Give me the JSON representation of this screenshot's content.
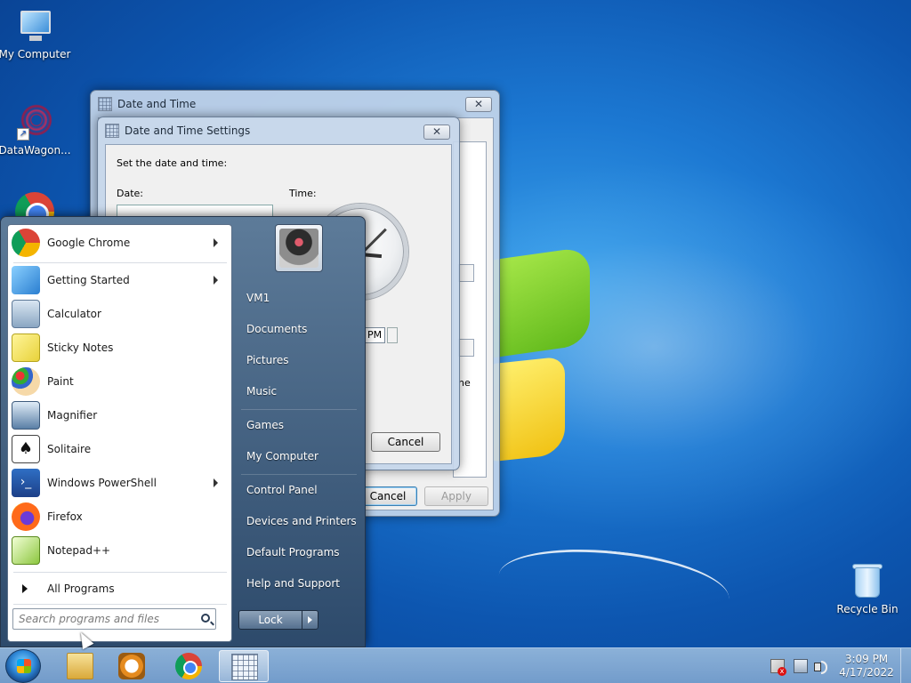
{
  "desktop": {
    "icons": [
      {
        "label": "My Computer",
        "icon": "computer-icon"
      },
      {
        "label": "DataWagon...",
        "icon": "datawagon-shortcut-icon"
      },
      {
        "label": "",
        "icon": "chrome-icon"
      },
      {
        "label": "Recycle Bin",
        "icon": "recycle-bin-icon"
      }
    ]
  },
  "window_datetime": {
    "title": "Date and Time",
    "close": "✕",
    "cancel_label": "Cancel",
    "apply_label": "Apply",
    "partial_text": "ne"
  },
  "window_settings": {
    "title": "Date and Time Settings",
    "close": "✕",
    "heading": "Set the date and time:",
    "date_label": "Date:",
    "time_label": "Time:",
    "ampm": "PM",
    "cancel_label": "Cancel"
  },
  "start_menu": {
    "programs": [
      {
        "label": "Google Chrome",
        "icon": "chrome-icon",
        "submenu": true
      },
      {
        "label": "Getting Started",
        "icon": "getting-started-icon",
        "submenu": true
      },
      {
        "label": "Calculator",
        "icon": "calculator-icon",
        "submenu": false
      },
      {
        "label": "Sticky Notes",
        "icon": "sticky-notes-icon",
        "submenu": false
      },
      {
        "label": "Paint",
        "icon": "paint-icon",
        "submenu": false
      },
      {
        "label": "Magnifier",
        "icon": "magnifier-icon",
        "submenu": false
      },
      {
        "label": "Solitaire",
        "icon": "solitaire-icon",
        "submenu": false
      },
      {
        "label": "Windows PowerShell",
        "icon": "powershell-icon",
        "submenu": true
      },
      {
        "label": "Firefox",
        "icon": "firefox-icon",
        "submenu": false
      },
      {
        "label": "Notepad++",
        "icon": "notepadpp-icon",
        "submenu": false
      }
    ],
    "all_programs": "All Programs",
    "search_placeholder": "Search programs and files",
    "right_items": [
      "VM1",
      "Documents",
      "Pictures",
      "Music",
      "Games",
      "My Computer",
      "Control Panel",
      "Devices and Printers",
      "Default Programs",
      "Help and Support"
    ],
    "lock_label": "Lock"
  },
  "taskbar": {
    "pinned": [
      "windows-explorer-icon",
      "media-player-icon",
      "chrome-icon",
      "date-time-icon"
    ],
    "time": "3:09 PM",
    "date": "4/17/2022"
  },
  "colors": {
    "desktop_blue": "#1c78d2",
    "start_menu": "#2d4a6b",
    "taskbar": "#8fb2d8"
  }
}
